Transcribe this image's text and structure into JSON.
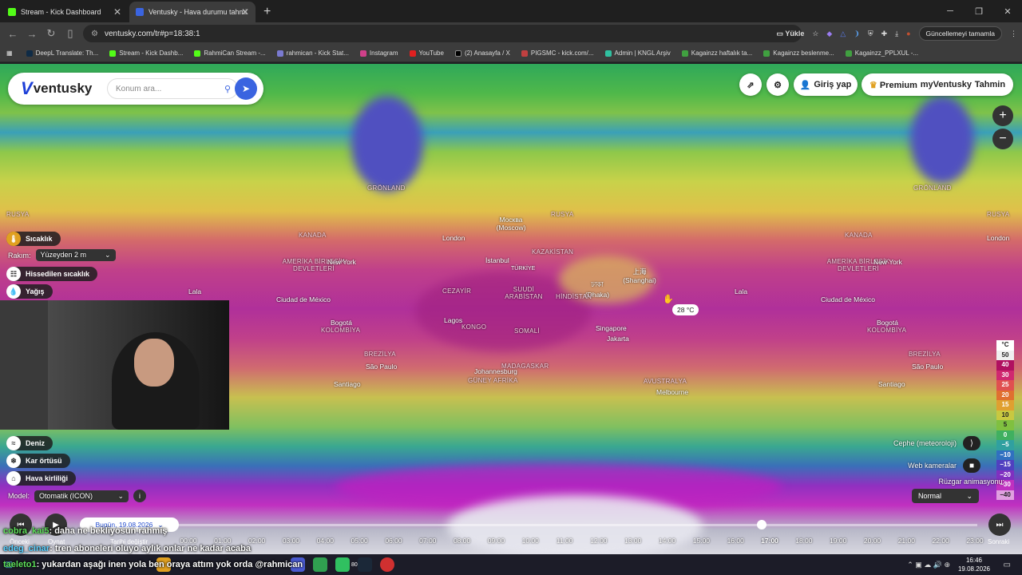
{
  "browser": {
    "tabs": [
      {
        "title": "Stream - Kick Dashboard",
        "color": "#53fc18"
      },
      {
        "title": "Ventusky - Hava durumu tahmi",
        "color": "#3a64e0"
      }
    ],
    "url": "ventusky.com/tr#p=18:38:1",
    "install_label": "Yükle",
    "update_label": "Güncellemeyi tamamla",
    "bookmarks": [
      "DeepL Translate: Th...",
      "Stream - Kick Dashb...",
      "RahmiCan Stream -...",
      "rahmican - Kick Stat...",
      "Instagram",
      "YouTube",
      "(2) Anasayfa / X",
      "PIGSMC - kick.com/...",
      "Admin | KNGL Arşiv",
      "Kagainzz haftalık ta...",
      "Kagainzz  beslenme...",
      "Kagainzz_PPLXUL -..."
    ]
  },
  "app": {
    "logo_text": "ventusky",
    "search_placeholder": "Konum ara...",
    "login_label": "Giriş yap",
    "premium_label": "Premium",
    "my_label": "myVentusky",
    "forecast_label": "Tahmin",
    "layers": {
      "temperature": "Sıcaklık",
      "height_label": "Rakım:",
      "height_value": "Yüzeyden 2 m",
      "feels_like": "Hissedilen sıcaklık",
      "precip": "Yağış",
      "sea": "Deniz",
      "snow": "Kar örtüsü",
      "air": "Hava kirliliği",
      "model_label": "Model:",
      "model_value": "Otomatik (ICON)"
    },
    "right": {
      "front": "Cephe (meteoroloji)",
      "webcams": "Web kameralar",
      "wind_anim_label": "Rüzgar animasyonu:",
      "wind_anim_value": "Normal"
    },
    "legend_unit": "°C",
    "legend_values": [
      "50",
      "40",
      "30",
      "25",
      "20",
      "15",
      "10",
      "5",
      "0",
      "−5",
      "−10",
      "−15",
      "−20",
      "−30",
      "−40"
    ],
    "legend_colors": [
      "#f0f0f0",
      "#b01060",
      "#d02870",
      "#e05050",
      "#e07030",
      "#e0a030",
      "#c8c840",
      "#80c040",
      "#40b060",
      "#30a0a0",
      "#3070c0",
      "#5040c0",
      "#8030c0",
      "#c030c0",
      "#e0a0e0"
    ],
    "tooltip": "28 °C",
    "map_labels": {
      "greenland": "GRÖNLAND",
      "russia": "RUSYA",
      "canada": "KANADA",
      "usa": "AMERİKA BİRLEŞİK DEVLETLERİ",
      "kazakhstan": "KAZAKİSTAN",
      "brazil": "BREZİLYA",
      "australia": "AVUSTRALYA",
      "saudi": "SUUDİ ARABİSTAN",
      "algeria": "CEZAYİR",
      "congo": "KONGO",
      "somali": "SOMALİ",
      "madagascar": "MADAGASKAR",
      "colombia": "KOLOMBİYA",
      "india": "HİNDİSTAN",
      "safrica": "GÜNEY AFRİKA",
      "turkey": "TÜRKİYE",
      "moscow": "Москва (Moscow)",
      "london": "London",
      "newyork": "New York",
      "mexico": "Ciudad de México",
      "bogota": "Bogotá",
      "saopaulo": "São Paulo",
      "santiago": "Santiago",
      "istanbul": "İstanbul",
      "dhaka": "ঢাকা (Dhaka)",
      "shanghai": "上海 (Shanghai)",
      "singapore": "Singapore",
      "jakarta": "Jakarta",
      "lagos": "Lagos",
      "johannesburg": "Johannesburg",
      "melbourne": "Melbourne",
      "lala1": "Lala",
      "lala2": "Lala"
    },
    "timeline": {
      "date": "Bugün, 19.08.2026",
      "prev": "Önceki",
      "play": "Oynat",
      "date_change": "Tarihi değiştir",
      "next": "Sonraki",
      "hours": [
        "00:00",
        "01:00",
        "02:00",
        "03:00",
        "04:00",
        "05:00",
        "06:00",
        "07:00",
        "08:00",
        "09:00",
        "10:00",
        "11:00",
        "12:00",
        "13:00",
        "14:00",
        "15:00",
        "16:00",
        "17:00",
        "18:00",
        "19:00",
        "20:00",
        "21:00",
        "22:00",
        "23:00"
      ],
      "current_hour": "17:00"
    }
  },
  "chat": [
    {
      "user": "cobra_kai5",
      "msg": ": daha ne bekliyosun rahmiş"
    },
    {
      "user": "edeg_cinar",
      "msg": ": tren aboneleri oluyo aylık onlar ne kadar acaba"
    },
    {
      "user": "taeleto1",
      "msg": ": yukardan aşağı inen yola ben oraya attım yok orda @rahmican"
    }
  ],
  "taskbar": {
    "time": "16:46",
    "date": "19.08.2026",
    "badge": "80"
  }
}
